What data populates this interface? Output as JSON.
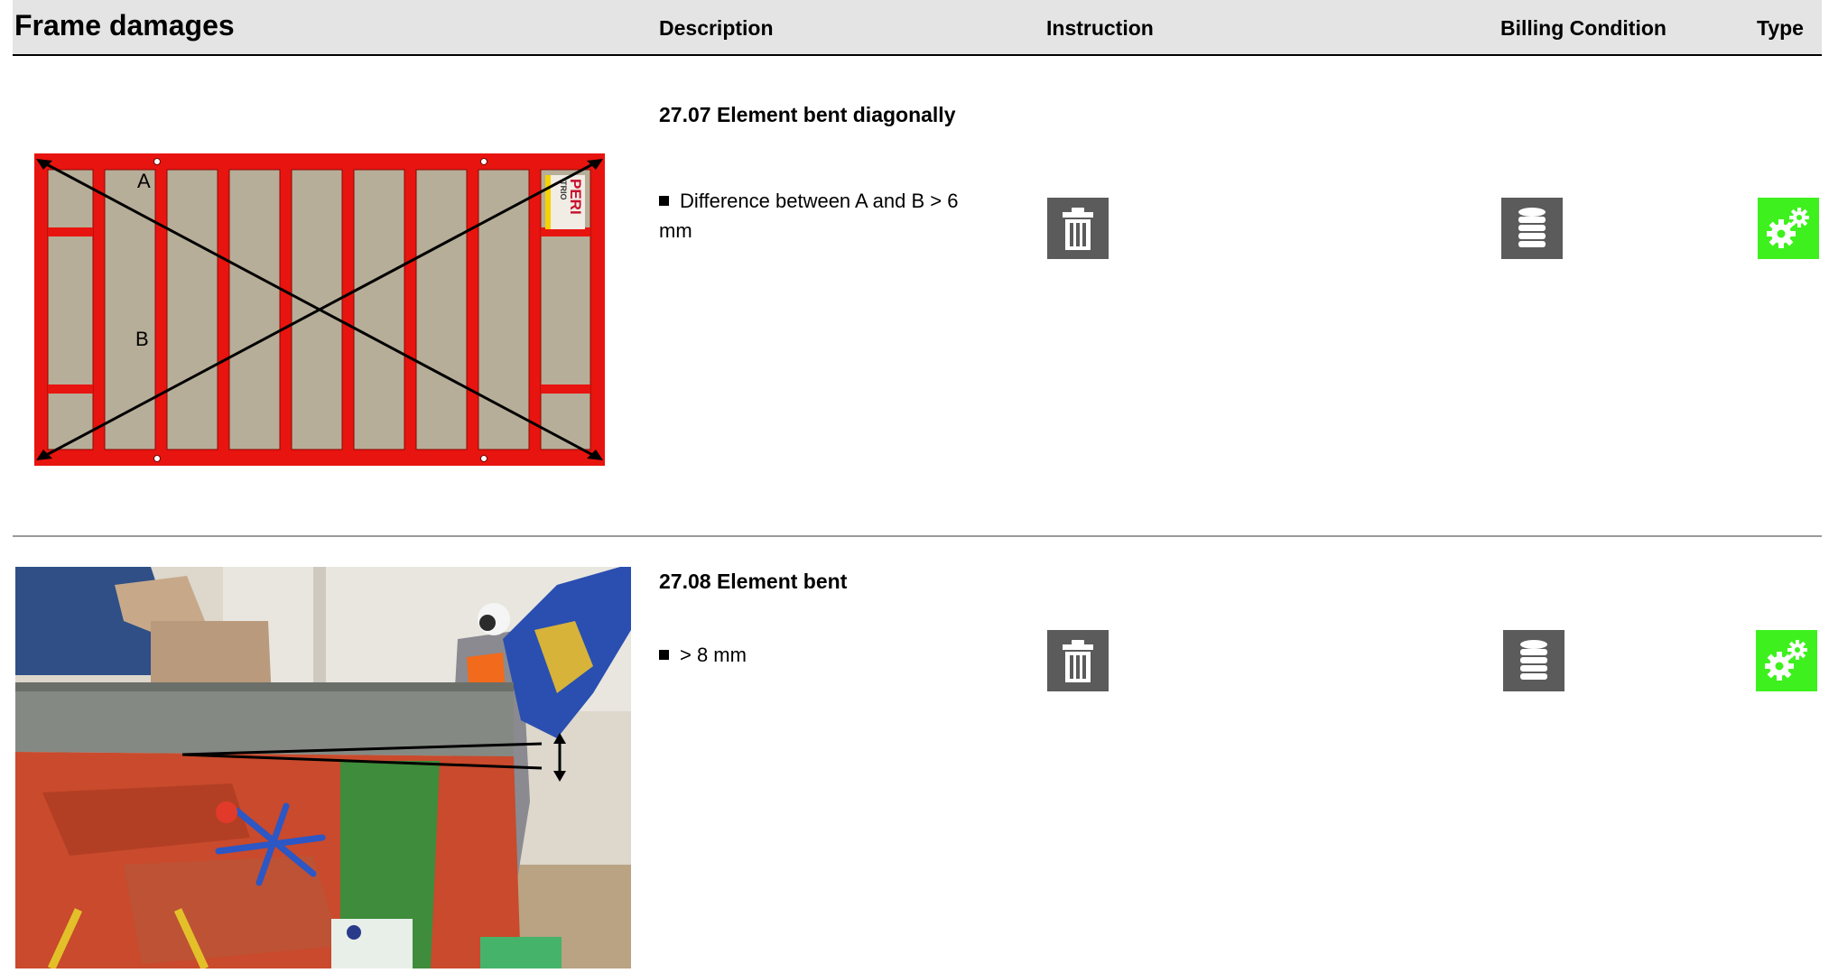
{
  "header": {
    "title": "Frame damages",
    "col_description": "Description",
    "col_instruction": "Instruction",
    "col_billing": "Billing Condition",
    "col_type": "Type"
  },
  "items": [
    {
      "title": "27.07 Element bent diagonally",
      "bullet": "Difference between A and B > 6 mm",
      "figure": {
        "label_a": "A",
        "label_b": "B",
        "brand": "PERI",
        "model": "TRIO"
      },
      "instruction_icon": "trash-icon",
      "billing_icon": "coin-stack-icon",
      "type_icon": "gears-icon"
    },
    {
      "title": "27.08 Element bent",
      "bullet": "> 8 mm",
      "instruction_icon": "trash-icon",
      "billing_icon": "coin-stack-icon",
      "type_icon": "gears-icon"
    }
  ],
  "colors": {
    "header_bg": "#e4e4e4",
    "icon_gray": "#5b5b5b",
    "type_green": "#3ef11e",
    "frame_red": "#e8140f",
    "panel_beige": "#b6ae98"
  }
}
